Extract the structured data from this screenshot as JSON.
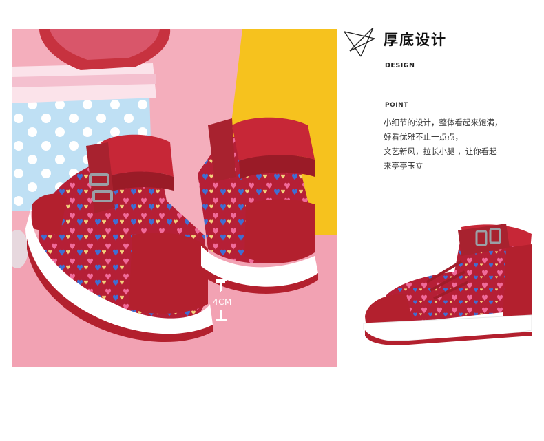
{
  "header": {
    "title": "厚底设计",
    "subtitle": "DESIGN"
  },
  "feature": {
    "label": "POINT",
    "lines": [
      "小细节的设计，整体看起来饱满，",
      "好看优雅不止一点点，",
      "文艺新风，拉长小腿 ，让你看起",
      "来亭亭玉立"
    ]
  },
  "photo": {
    "height_label": "4CM"
  },
  "colors": {
    "shoe_red": "#b3202e",
    "background_pink": "#f3a9b8",
    "backdrop_yellow": "#f6c21e",
    "heart_blue": "#3f6ed3",
    "heart_pink": "#f06b9a"
  },
  "icons": {
    "header": "star-sketch-icon",
    "measure": "height-measure-icon"
  }
}
